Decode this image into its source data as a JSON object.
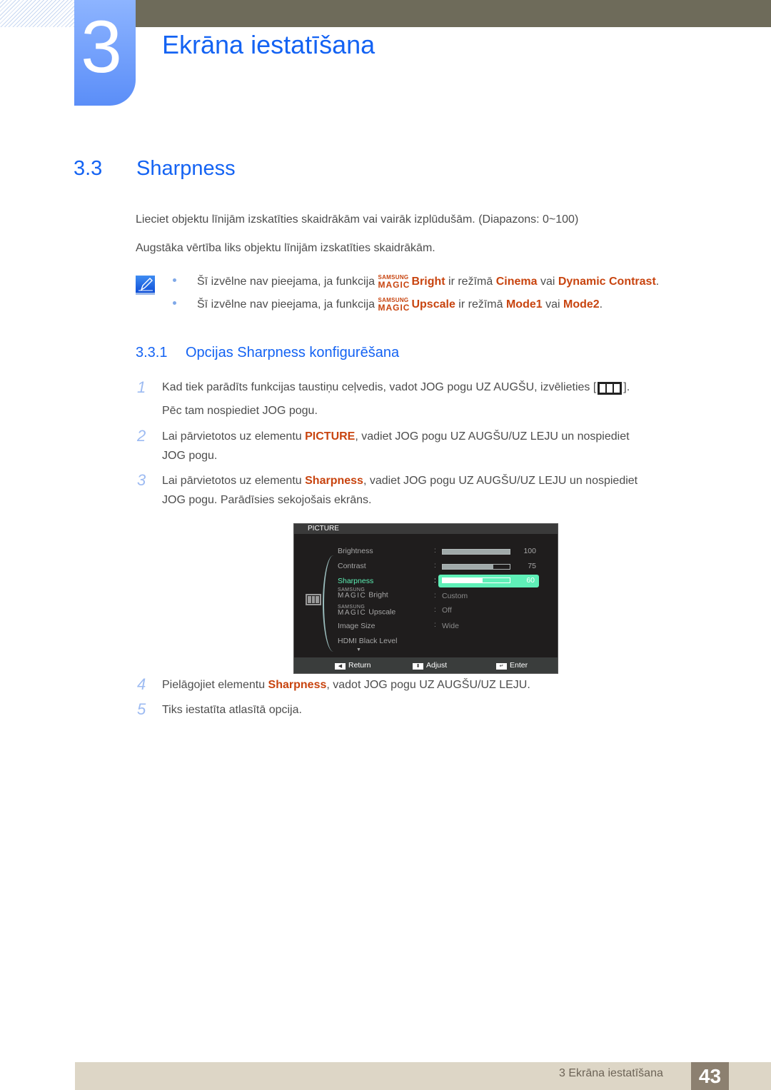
{
  "header": {
    "chapter_number": "3",
    "chapter_title": "Ekrāna iestatīšana"
  },
  "section": {
    "number": "3.3",
    "title": "Sharpness",
    "para1": "Lieciet objektu līnijām izskatīties skaidrākām vai vairāk izplūdušām. (Diapazons: 0~100)",
    "para2": "Augstāka vērtība liks objektu līnijām izskatīties skaidrākām."
  },
  "note": {
    "icon": "note-pencil-icon",
    "items": [
      {
        "prefix": "Šī izvēlne nav pieejama, ja funkcija ",
        "magic_top": "SAMSUNG",
        "magic_bottom": "MAGIC",
        "feature": "Bright",
        "mid": " ir režīmā ",
        "mode1": "Cinema",
        "joiner": " vai ",
        "mode2": "Dynamic Contrast",
        "end": "."
      },
      {
        "prefix": "Šī izvēlne nav pieejama, ja funkcija ",
        "magic_top": "SAMSUNG",
        "magic_bottom": "MAGIC",
        "feature": "Upscale",
        "mid": " ir režīmā ",
        "mode1": "Mode1",
        "joiner": " vai ",
        "mode2": "Mode2",
        "end": "."
      }
    ]
  },
  "subsection": {
    "number": "3.3.1",
    "title": "Opcijas Sharpness konfigurēšana"
  },
  "steps": [
    {
      "num": "1",
      "line1_a": "Kad tiek parādīts funkcijas taustiņu ceļvedis, vadot JOG pogu UZ AUGŠU, izvēlieties [",
      "line1_b": "].",
      "line2": "Pēc tam nospiediet JOG pogu."
    },
    {
      "num": "2",
      "line1_a": "Lai pārvietotos uz elementu ",
      "hl": "PICTURE",
      "line1_b": ", vadiet JOG pogu UZ AUGŠU/UZ LEJU un nospiediet",
      "line2": "JOG pogu."
    },
    {
      "num": "3",
      "line1_a": "Lai pārvietotos uz elementu ",
      "hl": "Sharpness",
      "line1_b": ", vadiet JOG pogu UZ AUGŠU/UZ LEJU un nospiediet",
      "line2": "JOG pogu. Parādīsies sekojošais ekrāns."
    },
    {
      "num": "4",
      "line1_a": "Pielāgojiet elementu ",
      "hl": "Sharpness",
      "line1_b": ", vadot JOG pogu UZ AUGŠU/UZ LEJU."
    },
    {
      "num": "5",
      "line1_a": "Tiks iestatīta atlasītā opcija."
    }
  ],
  "osd": {
    "title": "PICTURE",
    "menu_icon": "picture-menu-icon",
    "items": [
      {
        "label": "Brightness",
        "type": "bar",
        "value": 100,
        "display": "100"
      },
      {
        "label": "Contrast",
        "type": "bar",
        "value": 75,
        "display": "75"
      },
      {
        "label": "Sharpness",
        "type": "bar",
        "value": 60,
        "display": "60",
        "selected": true
      },
      {
        "magic_top": "SAMSUNG",
        "magic_bottom": "MAGIC",
        "label": "Bright",
        "type": "text",
        "display": "Custom"
      },
      {
        "magic_top": "SAMSUNG",
        "magic_bottom": "MAGIC",
        "label": "Upscale",
        "type": "text",
        "display": "Off"
      },
      {
        "label": "Image Size",
        "type": "text",
        "display": "Wide"
      },
      {
        "label": "HDMI Black Level",
        "type": "none"
      }
    ],
    "more_indicator": "▼",
    "footer": [
      {
        "icon": "return-key-icon",
        "glyph": "◀",
        "label": "Return"
      },
      {
        "icon": "adjust-key-icon",
        "glyph": "⬍",
        "label": "Adjust"
      },
      {
        "icon": "enter-key-icon",
        "glyph": "↵",
        "label": "Enter"
      }
    ]
  },
  "footer": {
    "chapter_label": "3 Ekrāna iestatīšana",
    "page_number": "43"
  }
}
